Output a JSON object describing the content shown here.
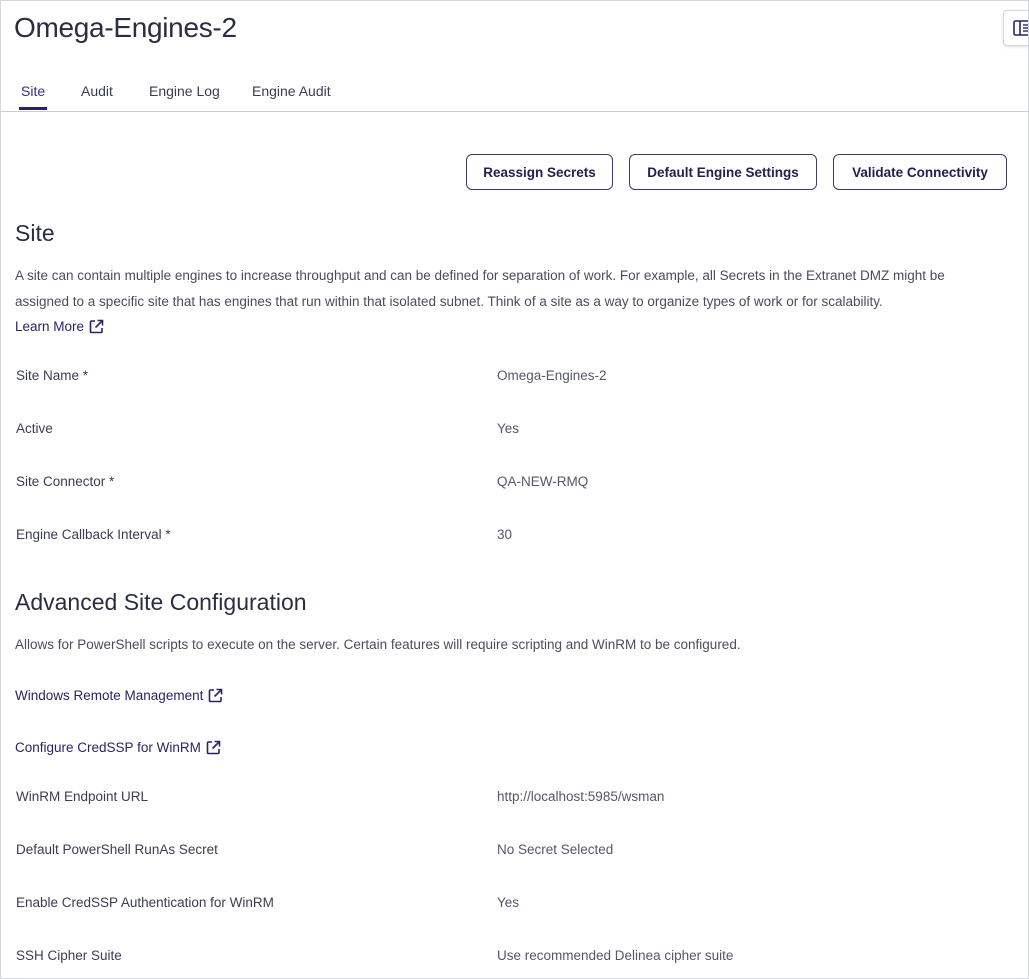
{
  "page": {
    "title": "Omega-Engines-2"
  },
  "tabs": [
    {
      "label": "Site",
      "active": true
    },
    {
      "label": "Audit",
      "active": false
    },
    {
      "label": "Engine Log",
      "active": false
    },
    {
      "label": "Engine Audit",
      "active": false
    }
  ],
  "actions": {
    "reassign_label": "Reassign Secrets",
    "defaults_label": "Default Engine Settings",
    "validate_label": "Validate Connectivity"
  },
  "site": {
    "heading": "Site",
    "description_line1": "A site can contain multiple engines to increase throughput and can be defined for separation of work. For example, all Secrets in the Extranet DMZ might be",
    "description_line2": "assigned to a specific site that has engines that run within that isolated subnet. Think of a site as a way to organize types of work or for scalability.",
    "learn_more": "Learn More",
    "fields": [
      {
        "label": "Site Name *",
        "value": "Omega-Engines-2"
      },
      {
        "label": "Active",
        "value": "Yes"
      },
      {
        "label": "Site Connector *",
        "value": "QA-NEW-RMQ"
      },
      {
        "label": "Engine Callback Interval *",
        "value": "30"
      }
    ]
  },
  "advanced": {
    "heading": "Advanced Site Configuration",
    "description": "Allows for PowerShell scripts to execute on the server. Certain features will require scripting and WinRM to be configured.",
    "link_winrm": "Windows Remote Management",
    "link_credssp": "Configure CredSSP for WinRM",
    "fields": [
      {
        "label": "WinRM Endpoint URL",
        "value": "http://localhost:5985/wsman"
      },
      {
        "label": "Default PowerShell RunAs Secret",
        "value": "No Secret Selected"
      },
      {
        "label": "Enable CredSSP Authentication for WinRM",
        "value": "Yes"
      },
      {
        "label": "SSH Cipher Suite",
        "value": "Use recommended Delinea cipher suite"
      }
    ]
  },
  "icons": {
    "external": "external-link-icon",
    "panel": "side-panel-icon"
  },
  "colors": {
    "accent": "#2b2266",
    "text": "#2e3045",
    "border": "#d6d7dd"
  }
}
